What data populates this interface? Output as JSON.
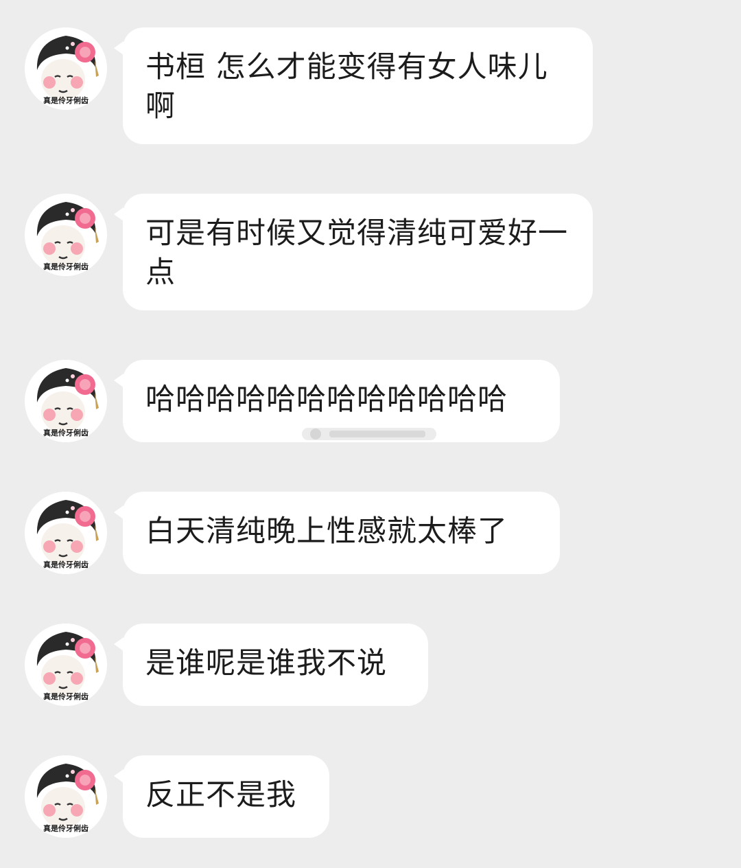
{
  "colors": {
    "background": "#ededed",
    "bubble": "#ffffff",
    "text": "#1c1c1c"
  },
  "avatar": {
    "icon": "meme-avatar-flower-headdress",
    "caption": "真是伶牙俐齿"
  },
  "messages": [
    {
      "text": "书桓 怎么才能变得有女人味儿啊"
    },
    {
      "text": "可是有时候又觉得清纯可爱好一点"
    },
    {
      "text": "哈哈哈哈哈哈哈哈哈哈哈哈"
    },
    {
      "text": "白天清纯晚上性感就太棒了"
    },
    {
      "text": "是谁呢是谁我不说"
    },
    {
      "text": "反正不是我"
    }
  ]
}
